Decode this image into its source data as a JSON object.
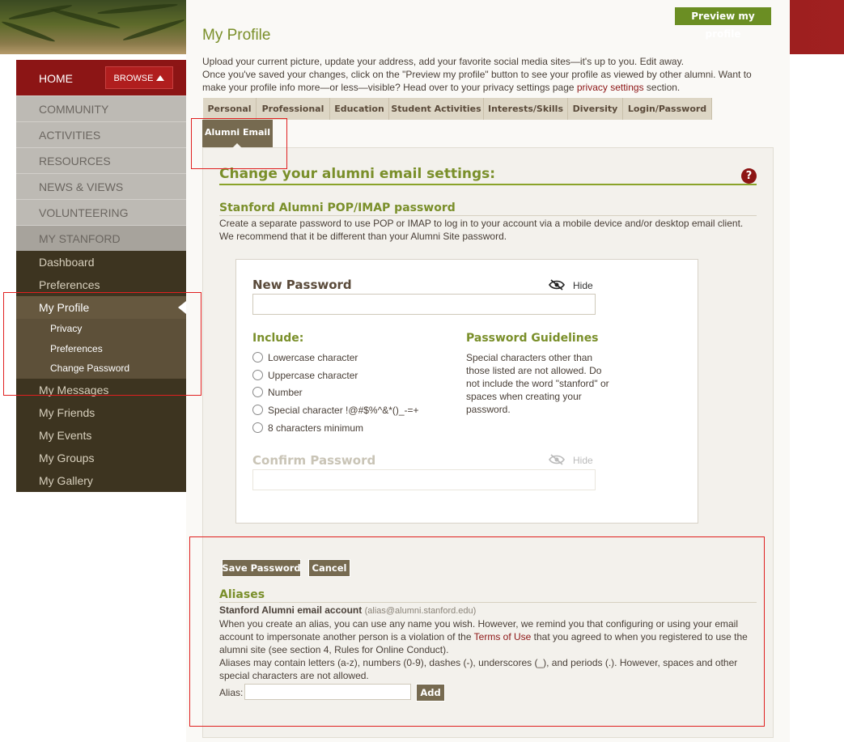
{
  "header": {
    "preview_label": "Preview my profile"
  },
  "nav": {
    "home_label": "HOME",
    "browse_label": "BROWSE",
    "sections": [
      "COMMUNITY",
      "ACTIVITIES",
      "RESOURCES",
      "NEWS & VIEWS",
      "VOLUNTEERING"
    ],
    "my_stanford_label": "MY STANFORD",
    "my_stanford_items": [
      "Dashboard",
      "Preferences"
    ],
    "my_profile_label": "My Profile",
    "profile_sub_items": [
      "Privacy",
      "Preferences",
      "Change Password"
    ],
    "more_items": [
      "My Messages",
      "My Friends",
      "My Events",
      "My Groups",
      "My Gallery"
    ]
  },
  "page": {
    "title": "My Profile",
    "intro_line1": "Upload your current picture, update your address, add your favorite social media sites—it's up to you. Edit away.",
    "intro_line2a": "Once you've saved your changes, click on the \"Preview my profile\" button to see your profile as viewed by other alumni. Want to make your profile info more—or less—visible? Head over to your privacy settings page ",
    "intro_link": "privacy settings",
    "intro_line2b": " section."
  },
  "tabs": [
    "Personal",
    "Professional",
    "Education",
    "Student Activities",
    "Interests/Skills",
    "Diversity",
    "Login/Password"
  ],
  "active_tab": "Alumni Email",
  "email_settings": {
    "heading": "Change your alumni email settings:",
    "help_icon": "?",
    "pop_heading": "Stanford Alumni POP/IMAP password",
    "pop_desc_1": "Create a separate password to use POP or IMAP to log in to your account via a mobile device and/or desktop email client.",
    "pop_desc_2": "We recommend that it be different than your Alumni Site password."
  },
  "password_form": {
    "new_label": "New Password",
    "hide_label": "Hide",
    "new_value": "",
    "include_heading": "Include:",
    "include_items": [
      "Lowercase character",
      "Uppercase character",
      "Number",
      "Special character !@#$%^&*()_-=+",
      "8 characters minimum"
    ],
    "guidelines_heading": "Password Guidelines",
    "guidelines_text": "Special characters other than those listed are not allowed. Do not include the word \"stanford\" or spaces when creating your password.",
    "confirm_label": "Confirm Password",
    "confirm_hide_label": "Hide",
    "confirm_value": ""
  },
  "actions": {
    "save_label": "Save Password",
    "cancel_label": "Cancel"
  },
  "aliases": {
    "heading": "Aliases",
    "account_label": "Stanford Alumni email account",
    "account_hint": "(alias@alumni.stanford.edu)",
    "text_1a": "When you create an alias, you can use any name you wish. However, we remind you that configuring or using your email account to impersonate another person is a violation of the ",
    "terms_link": "Terms of Use",
    "text_1b": " that you agreed to when you registered to use the alumni site (see section 4, Rules for Online Conduct).",
    "text_2": "Aliases may contain letters (a-z), numbers (0-9), dashes (-), underscores (_), and periods (.). However, spaces and other special characters are not allowed.",
    "alias_label": "Alias:",
    "alias_value": "",
    "add_label": "Add"
  },
  "colors": {
    "cardinal": "#8c1515",
    "olive": "#7a8f2a",
    "nav_dark": "#3d3420",
    "button_brown": "#766a50"
  }
}
